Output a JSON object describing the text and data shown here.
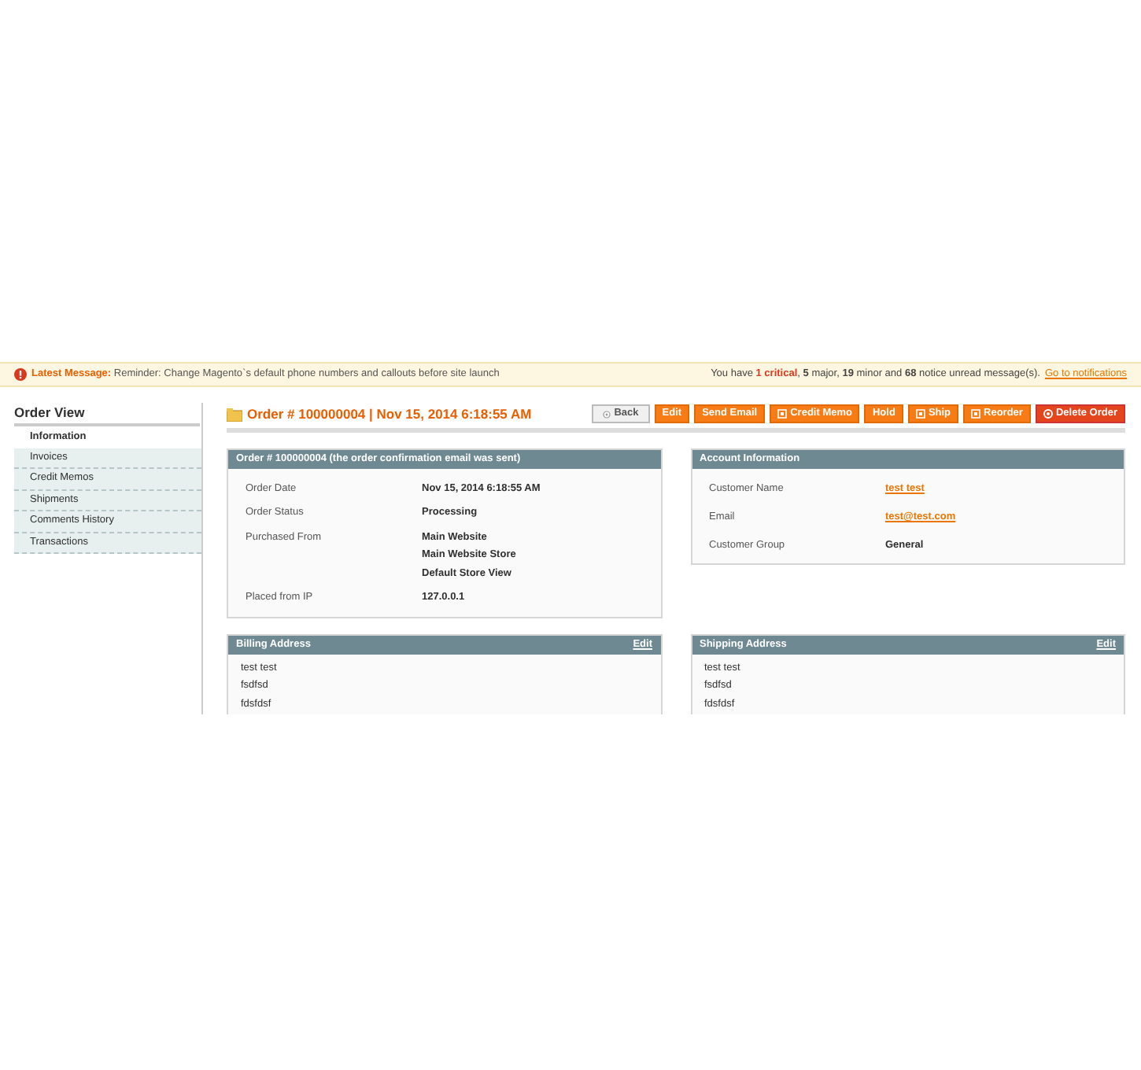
{
  "notice": {
    "label": "Latest Message:",
    "message": "Reminder: Change Magento`s default phone numbers and callouts before site launch",
    "summary": [
      {
        "kind": "plain",
        "text": "You have "
      },
      {
        "kind": "critical",
        "text": "1 critical"
      },
      {
        "kind": "plain",
        "text": ", "
      },
      {
        "kind": "count",
        "text": "5"
      },
      {
        "kind": "plain",
        "text": " major, "
      },
      {
        "kind": "count",
        "text": "19"
      },
      {
        "kind": "plain",
        "text": " minor and "
      },
      {
        "kind": "count",
        "text": "68"
      },
      {
        "kind": "plain",
        "text": " notice unread message(s)."
      }
    ],
    "link": "Go to notifications"
  },
  "sidebar": {
    "title": "Order View",
    "items": [
      {
        "label": "Information",
        "selected": true
      },
      {
        "label": "Invoices",
        "selected": false
      },
      {
        "label": "Credit Memos",
        "selected": false
      },
      {
        "label": "Shipments",
        "selected": false
      },
      {
        "label": "Comments History",
        "selected": false
      },
      {
        "label": "Transactions",
        "selected": false
      }
    ]
  },
  "page_title": "Order # 100000004 | Nov 15, 2014 6:18:55 AM",
  "buttons": [
    {
      "kind": "back",
      "label": "Back"
    },
    {
      "kind": "plain",
      "label": "Edit"
    },
    {
      "kind": "plain",
      "label": "Send Email"
    },
    {
      "kind": "doc",
      "label": "Credit Memo"
    },
    {
      "kind": "plain",
      "label": "Hold"
    },
    {
      "kind": "doc",
      "label": "Ship"
    },
    {
      "kind": "doc",
      "label": "Reorder"
    },
    {
      "kind": "delete",
      "label": "Delete Order"
    }
  ],
  "order_panel": {
    "title": "Order # 100000004 (the order confirmation email was sent)",
    "rows": [
      {
        "label": "Order Date",
        "value": [
          "Nov 15, 2014 6:18:55 AM"
        ]
      },
      {
        "label": "Order Status",
        "value": [
          "Processing"
        ]
      },
      {
        "label": "Purchased From",
        "value": [
          "Main Website",
          "Main Website Store",
          "Default Store View"
        ]
      },
      {
        "label": "Placed from IP",
        "value": [
          "127.0.0.1"
        ]
      }
    ]
  },
  "account_panel": {
    "title": "Account Information",
    "rows": [
      {
        "label": "Customer Name",
        "value": "test test",
        "link": true
      },
      {
        "label": "Email",
        "value": "test@test.com",
        "link": true
      },
      {
        "label": "Customer Group",
        "value": "General",
        "link": false
      }
    ]
  },
  "billing_panel": {
    "title": "Billing Address",
    "action": "Edit",
    "lines": [
      "test test",
      "fsdfsd",
      "fdsfdsf"
    ]
  },
  "shipping_panel": {
    "title": "Shipping Address",
    "action": "Edit",
    "lines": [
      "test test",
      "fsdfsd",
      "fdsfdsf"
    ]
  }
}
